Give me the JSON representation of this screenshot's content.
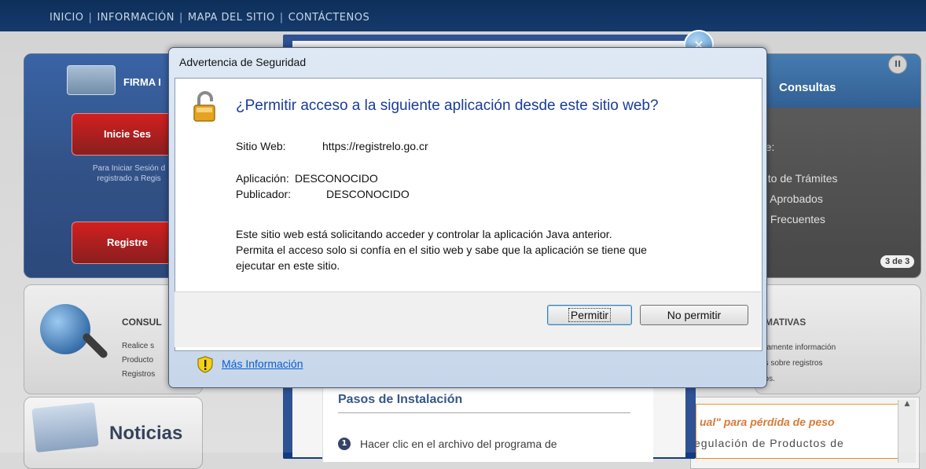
{
  "nav": {
    "items": [
      "INICIO",
      "INFORMACIÓN",
      "MAPA DEL SITIO",
      "CONTÁCTENOS"
    ],
    "separator": "|"
  },
  "background": {
    "firma": {
      "title": "FIRMA I",
      "login_button": "Inicie Ses",
      "note_line1": "Para Iniciar Sesión d",
      "note_line2": "registrado a Regis",
      "register_button": "Registre"
    },
    "consulta": {
      "title": "CONSUL",
      "lines": [
        "Realice s",
        "Producto",
        "Registros"
      ]
    },
    "noticias": {
      "title": "Noticias"
    },
    "consultas": {
      "title": "Consultas",
      "pause": "II",
      "items": [
        "re:",
        "nto de Trámites",
        "s Aprobados",
        "s Frecuentes"
      ],
      "page_badge": "3 de 3"
    },
    "normativas": {
      "title": "MATIVAS",
      "lines": [
        "mamente información",
        "es sobre registros",
        "rios."
      ]
    },
    "promo": {
      "title": "ual\" para pérdida de peso",
      "text": "egulación de Productos de"
    },
    "install": {
      "title": "Pasos de Instalación",
      "step_number": "1",
      "step_text": "Hacer clic en el archivo del programa de"
    }
  },
  "dialog": {
    "title": "Advertencia de Seguridad",
    "heading": "¿Permitir acceso a la siguiente aplicación desde este sitio web?",
    "site_label": "Sitio Web:",
    "site_value": "https://registrelo.go.cr",
    "app_label": "Aplicación:",
    "app_value": "DESCONOCIDO",
    "publisher_label": "Publicador:",
    "publisher_value": "DESCONOCIDO",
    "warning_line1": "Este sitio web está solicitando acceder y controlar la aplicación Java anterior.",
    "warning_line2": "Permita el acceso solo si confía en el sitio web y sabe que la aplicación se tiene que",
    "warning_line3": "ejecutar en este sitio.",
    "allow_button": "Permitir",
    "deny_button": "No permitir",
    "more_info_link": "Más Información"
  },
  "icons": {
    "lock": "lock-open-icon",
    "shield": "shield-warning-icon",
    "close": "close-icon"
  },
  "colors": {
    "nav_bg": "#0e2f5a",
    "heading": "#1a3c97",
    "link": "#0a5fcf",
    "accent_red": "#c00000"
  }
}
